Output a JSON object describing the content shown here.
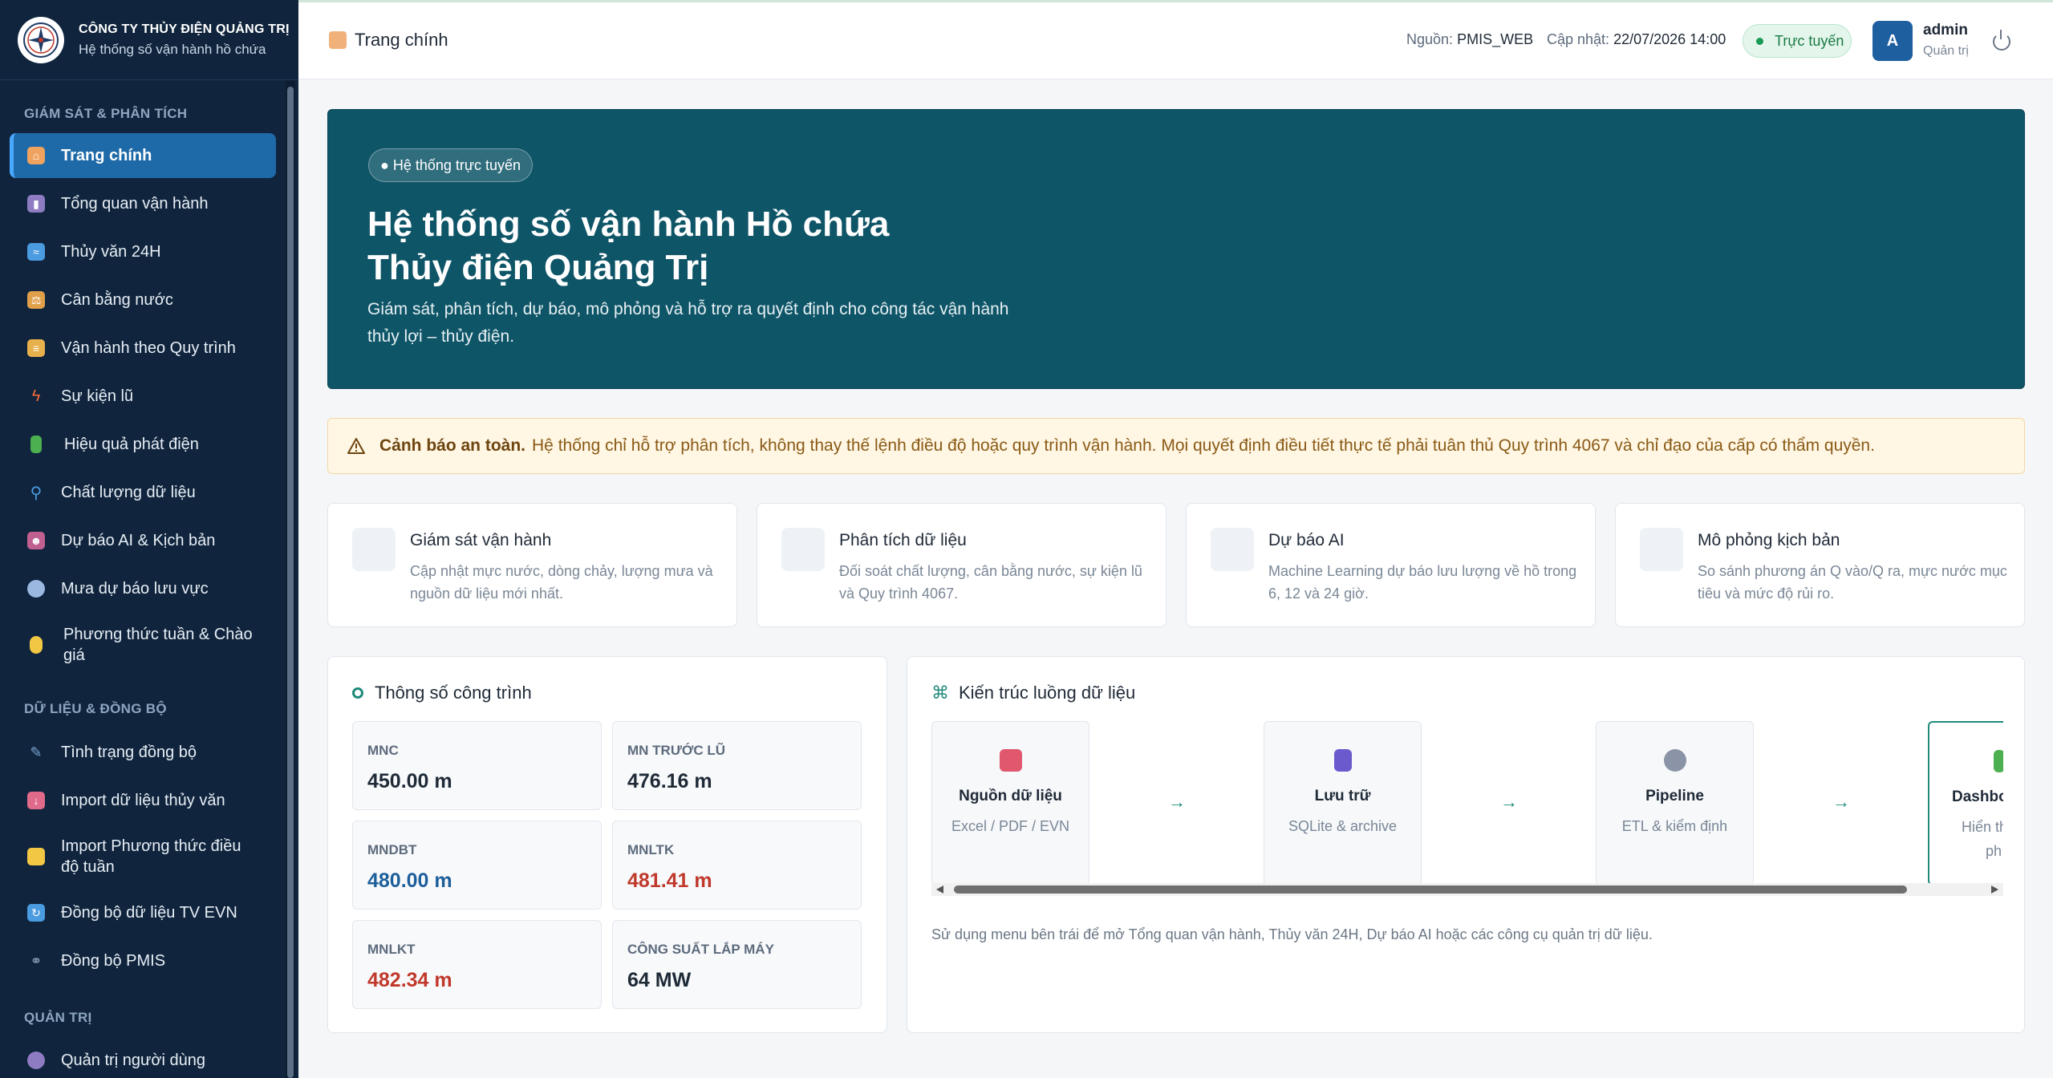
{
  "brand": {
    "name": "CÔNG TY THỦY ĐIỆN QUẢNG TRỊ",
    "subtitle": "Hệ thống số vận hành hồ chứa"
  },
  "sidebar": {
    "sections": [
      {
        "title": "GIÁM SÁT & PHÂN TÍCH"
      },
      {
        "title": "DỮ LIỆU & ĐỒNG BỘ"
      },
      {
        "title": "QUẢN TRỊ"
      }
    ],
    "items": [
      {
        "label": "Trang chính",
        "icon": "home-icon",
        "color": "#f0a35e"
      },
      {
        "label": "Tổng quan vận hành",
        "icon": "bar-chart-icon",
        "color": "#8e7cc3"
      },
      {
        "label": "Thủy văn 24H",
        "icon": "wave-icon",
        "color": "#4a9be0"
      },
      {
        "label": "Cân bằng nước",
        "icon": "scale-icon",
        "color": "#e0a04a"
      },
      {
        "label": "Vận hành theo Quy trình",
        "icon": "scroll-icon",
        "color": "#e8b04a"
      },
      {
        "label": "Sự kiện lũ",
        "icon": "lightning-icon",
        "color": "#ef6a3a"
      },
      {
        "label": "Hiệu quả phát điện",
        "icon": "battery-icon",
        "color": "#4caf50"
      },
      {
        "label": "Chất lượng dữ liệu",
        "icon": "magnifier-icon",
        "color": "#4a9be0"
      },
      {
        "label": "Dự báo AI & Kịch bản",
        "icon": "robot-icon",
        "color": "#c06090"
      },
      {
        "label": "Mưa dự báo lưu vực",
        "icon": "cloud-rain-icon",
        "color": "#9ab8e0"
      },
      {
        "label": "Phương thức tuần & Chào giá",
        "icon": "lightbulb-icon",
        "color": "#f2c744"
      },
      {
        "label": "Tình trạng đồng bộ",
        "icon": "syringe-icon",
        "color": "#7ea6d9"
      },
      {
        "label": "Import dữ liệu thủy văn",
        "icon": "inbox-icon",
        "color": "#e06a8a"
      },
      {
        "label": "Import Phương thức điều độ tuần",
        "icon": "folder-icon",
        "color": "#f2c744"
      },
      {
        "label": "Đồng bộ dữ liệu TV EVN",
        "icon": "refresh-icon",
        "color": "#4a9be0"
      },
      {
        "label": "Đồng bộ PMIS",
        "icon": "link-icon",
        "color": "#8aa0b8"
      },
      {
        "label": "Quản trị người dùng",
        "icon": "users-icon",
        "color": "#8e7cc3"
      }
    ]
  },
  "header": {
    "breadcrumb": "Trang chính",
    "source_label": "Nguồn:",
    "source_value": "PMIS_WEB",
    "updated_label": "Cập nhật:",
    "updated_value": "22/07/2026 14:00",
    "status": "Trực tuyến",
    "user": {
      "initial": "A",
      "name": "admin",
      "role": "Quản trị"
    }
  },
  "hero": {
    "badge": "● Hệ thống trực tuyến",
    "title": "Hệ thống số vận hành Hồ chứa Thủy điện Quảng Trị",
    "description": "Giám sát, phân tích, dự báo, mô phỏng và hỗ trợ ra quyết định cho công tác vận hành thủy lợi – thủy điện."
  },
  "alert": {
    "title": "Cảnh báo an toàn.",
    "text": "Hệ thống chỉ hỗ trợ phân tích, không thay thế lệnh điều độ hoặc quy trình vận hành. Mọi quyết định điều tiết thực tế phải tuân thủ Quy trình 4067 và chỉ đạo của cấp có thẩm quyền."
  },
  "features": [
    {
      "title": "Giám sát vận hành",
      "desc": "Cập nhật mực nước, dòng chảy, lượng mưa và nguồn dữ liệu mới nhất.",
      "icon": "syringe-icon"
    },
    {
      "title": "Phân tích dữ liệu",
      "desc": "Đối soát chất lượng, cân bằng nước, sự kiện lũ và Quy trình 4067.",
      "icon": "magnifier-icon"
    },
    {
      "title": "Dự báo AI",
      "desc": "Machine Learning dự báo lưu lượng về hồ trong 6, 12 và 24 giờ.",
      "icon": "robot-icon"
    },
    {
      "title": "Mô phỏng kịch bản",
      "desc": "So sánh phương án Q vào/Q ra, mực nước mục tiêu và mức độ rủi ro.",
      "icon": "test-tube-icon"
    }
  ],
  "specs": {
    "title": "Thông số công trình",
    "items": [
      {
        "label": "MNC",
        "value": "450.00 m",
        "color": "#1f2a37"
      },
      {
        "label": "MN TRƯỚC LŨ",
        "value": "476.16 m",
        "color": "#1f2a37"
      },
      {
        "label": "MNDBT",
        "value": "480.00 m",
        "color": "#1d5f9a"
      },
      {
        "label": "MNLTK",
        "value": "481.41 m",
        "color": "#c0392b"
      },
      {
        "label": "MNLKT",
        "value": "482.34 m",
        "color": "#c0392b"
      },
      {
        "label": "CÔNG SUẤT LẮP MÁY",
        "value": "64 MW",
        "color": "#1f2a37"
      }
    ]
  },
  "flow": {
    "title": "Kiến trúc luồng dữ liệu",
    "arrow": "→",
    "steps": [
      {
        "name": "Nguồn dữ liệu",
        "desc": "Excel / PDF / EVN",
        "icon": "inbox-icon",
        "color": "#e0576e"
      },
      {
        "name": "Lưu trữ",
        "desc": "SQLite & archive",
        "icon": "database-icon",
        "color": "#6a5acd"
      },
      {
        "name": "Pipeline",
        "desc": "ETL & kiểm định",
        "icon": "gear-icon",
        "color": "#8a94a6"
      },
      {
        "name": "Dashbo",
        "desc": "Hiển th",
        "desc2": "ph",
        "icon": "battery-icon",
        "color": "#4caf50"
      }
    ],
    "note": "Sử dụng menu bên trái để mở Tổng quan vận hành, Thủy văn 24H, Dự báo AI hoặc các công cụ quản trị dữ liệu."
  }
}
